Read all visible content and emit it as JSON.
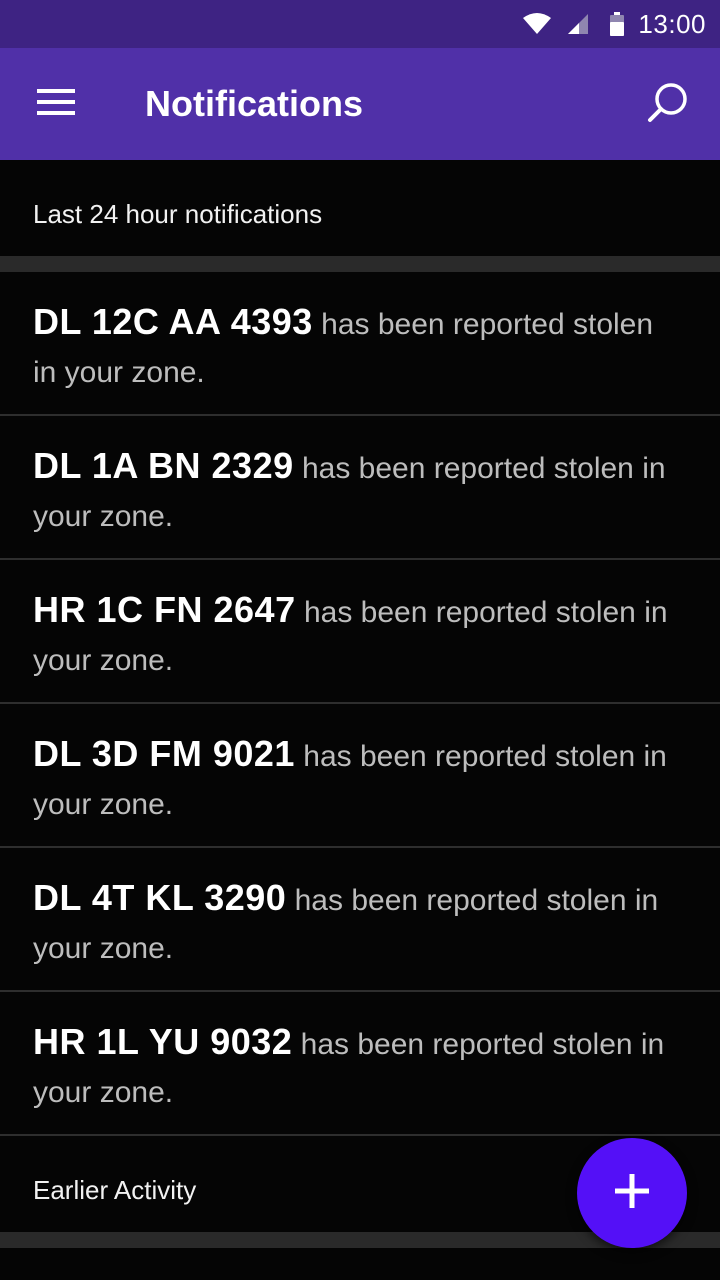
{
  "status_bar": {
    "time": "13:00",
    "icons": [
      "wifi-icon",
      "signal-icon",
      "battery-icon"
    ]
  },
  "app_bar": {
    "title": "Notifications",
    "menu_icon": "hamburger-menu-icon",
    "search_icon": "search-icon"
  },
  "sections": {
    "recent_label": "Last 24 hour notifications",
    "earlier_label": "Earlier Activity"
  },
  "notifications": [
    {
      "plate": "DL 12C AA 4393",
      "message": "has been reported stolen in your zone."
    },
    {
      "plate": "DL 1A BN 2329",
      "message": "has been reported stolen in your zone."
    },
    {
      "plate": "HR 1C FN 2647",
      "message": "has been reported stolen in your zone."
    },
    {
      "plate": "DL 3D FM 9021",
      "message": "has been reported stolen in your zone."
    },
    {
      "plate": "DL 4T KL 3290",
      "message": "has been reported stolen in your zone."
    },
    {
      "plate": "HR 1L YU 9032",
      "message": "has been reported stolen in your zone."
    }
  ],
  "fab": {
    "icon": "plus-icon"
  },
  "colors": {
    "status_bar": "#3e2383",
    "app_bar": "#5030a8",
    "fab": "#5410f7",
    "background": "#050505"
  }
}
